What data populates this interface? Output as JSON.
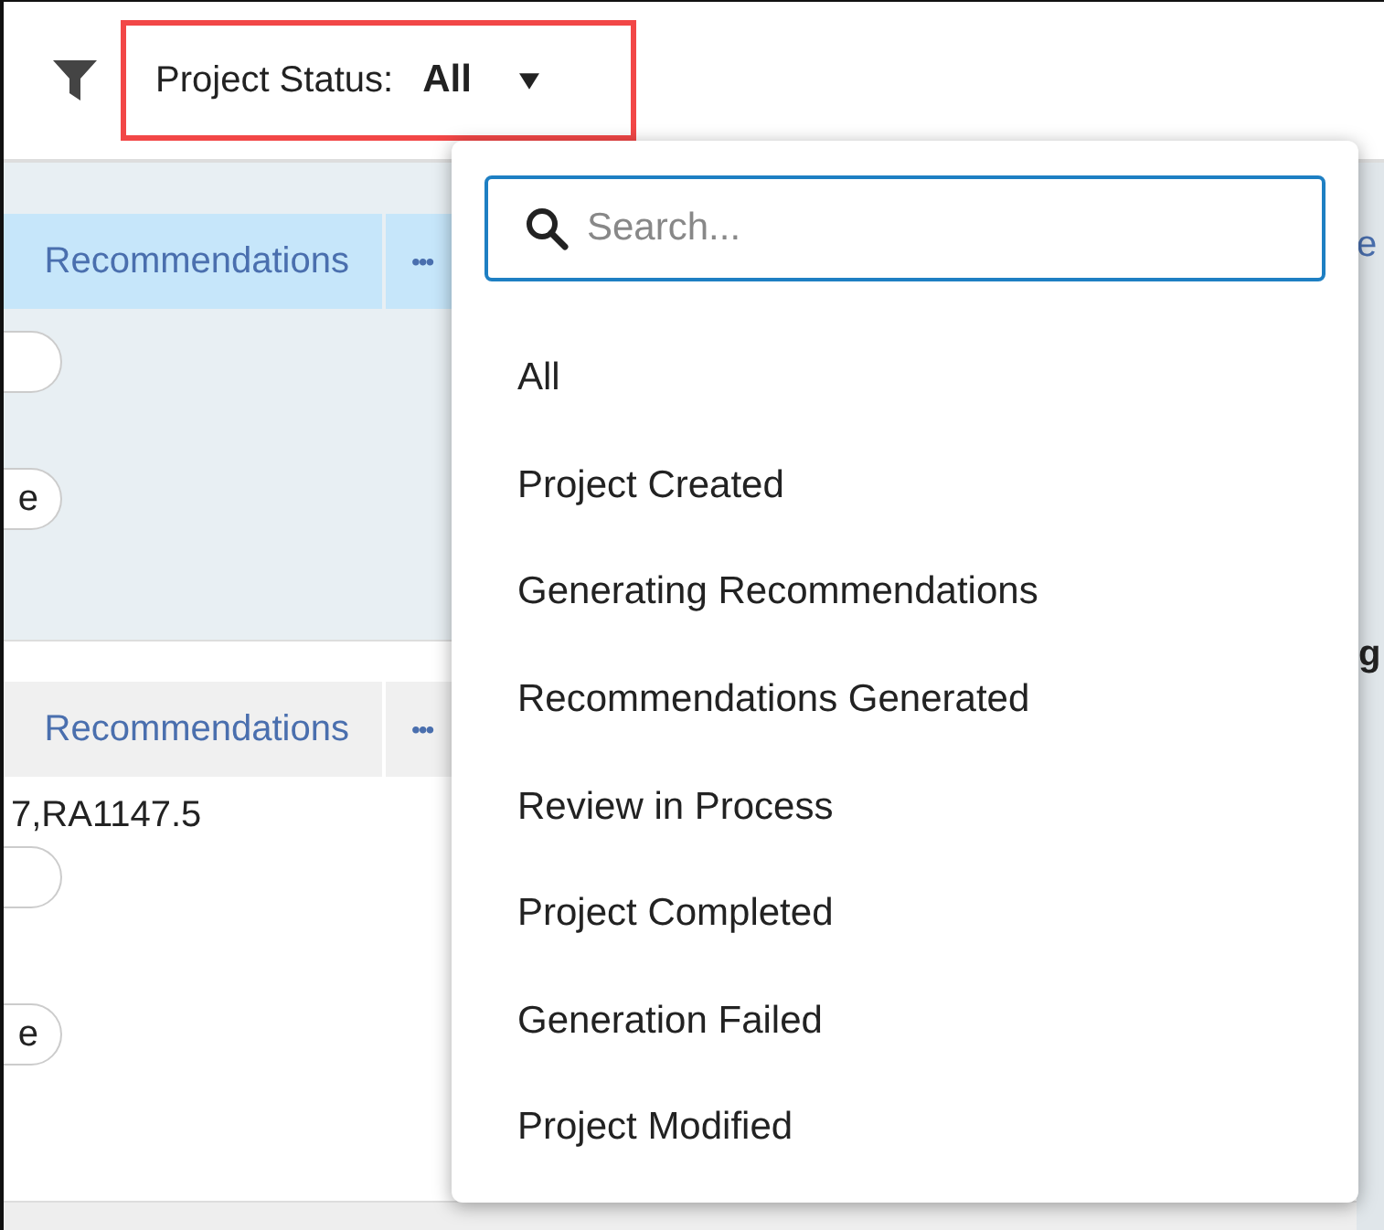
{
  "filter": {
    "label": "Project Status:",
    "value": "All"
  },
  "search": {
    "placeholder": "Search..."
  },
  "options": [
    {
      "label": "All"
    },
    {
      "label": "Project Created"
    },
    {
      "label": "Generating Recommendations"
    },
    {
      "label": "Recommendations Generated"
    },
    {
      "label": "Review in Process"
    },
    {
      "label": "Project Completed"
    },
    {
      "label": "Generation Failed"
    },
    {
      "label": "Project Modified"
    }
  ],
  "cards": [
    {
      "header": "Recommendations",
      "more": "•••",
      "selected": true,
      "pills": [
        {
          "kind": "blank"
        },
        {
          "kind": "text",
          "text": "e"
        }
      ]
    },
    {
      "header": "Recommendations",
      "more": "•••",
      "selected": false,
      "line": "7,RA1147.5",
      "pills": [
        {
          "kind": "blank"
        },
        {
          "kind": "text",
          "text": "e"
        }
      ]
    }
  ],
  "right_edge": {
    "header_fragment": "e",
    "label_fragment": "g"
  }
}
